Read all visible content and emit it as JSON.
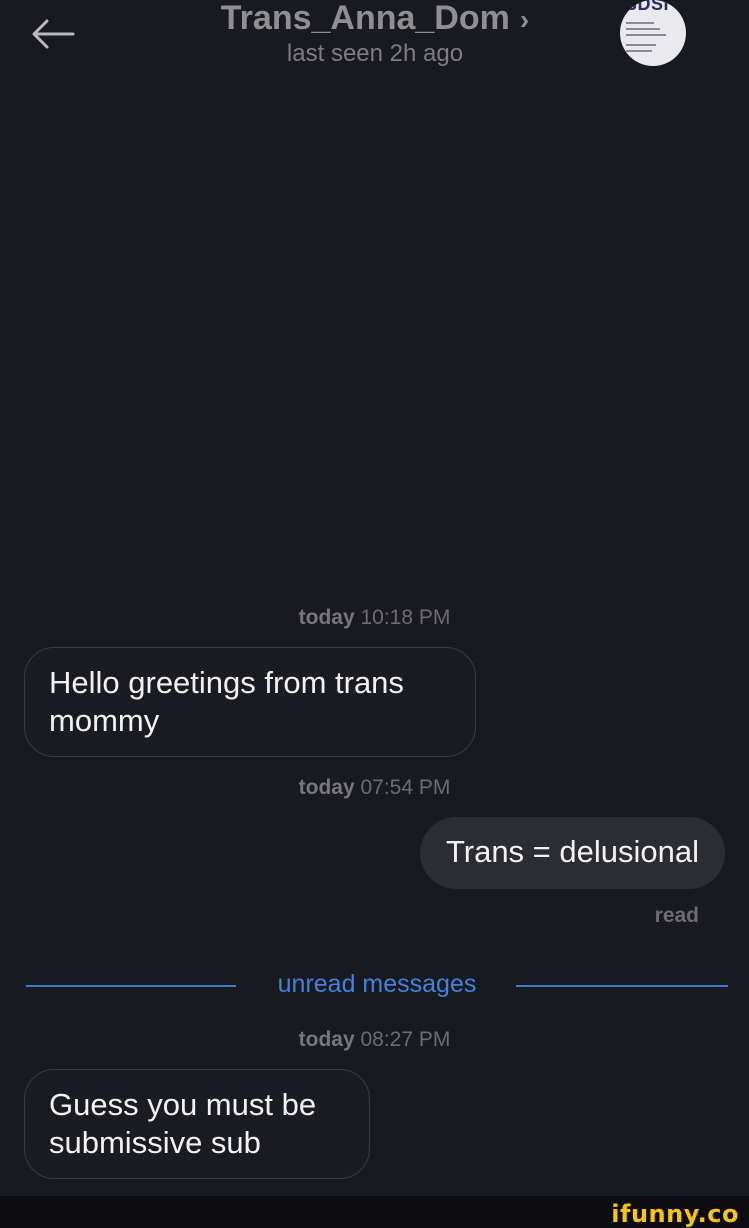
{
  "header": {
    "title": "Trans_Anna_Dom",
    "chevron": "›",
    "subtitle": "last seen 2h ago",
    "back_icon": "arrow-left-icon",
    "avatar_text": "BDSI"
  },
  "messages": [
    {
      "type": "timestamp",
      "day": "today",
      "time": "10:18 PM"
    },
    {
      "type": "incoming",
      "text": "Hello greetings from trans mommy"
    },
    {
      "type": "timestamp",
      "day": "today",
      "time": "07:54 PM"
    },
    {
      "type": "outgoing",
      "text": "Trans = delusional",
      "status": "read"
    },
    {
      "type": "divider",
      "label": "unread messages"
    },
    {
      "type": "timestamp",
      "day": "today",
      "time": "08:27 PM"
    },
    {
      "type": "incoming",
      "text": "Guess you must be submissive sub"
    }
  ],
  "watermark": {
    "text": "ifunny.co",
    "color": "#f6c514"
  },
  "colors": {
    "background": "#191a1f",
    "accent": "#3f82e0",
    "outgoing_bubble": "#2c2d32"
  }
}
